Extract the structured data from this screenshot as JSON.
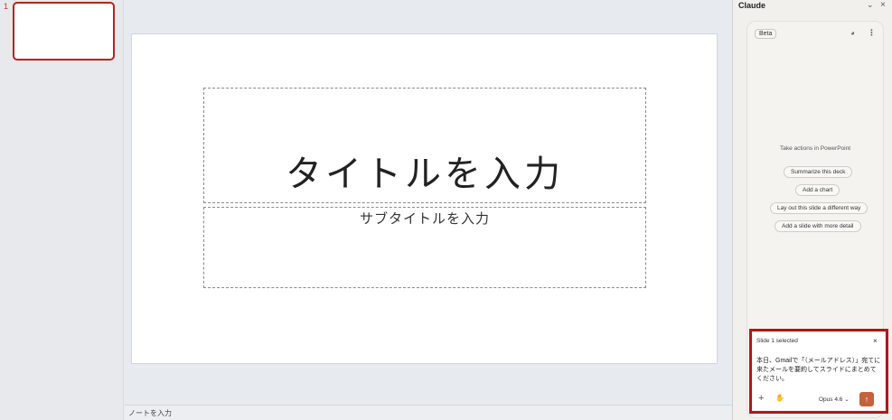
{
  "thumbnails": {
    "slide_number": "1"
  },
  "slide": {
    "title_placeholder": "タイトルを入力",
    "subtitle_placeholder": "サブタイトルを入力"
  },
  "notes": {
    "placeholder": "ノートを入力"
  },
  "claude_pane": {
    "title": "Claude",
    "badge": "Beta",
    "actions_heading": "Take actions in PowerPoint",
    "suggestions": [
      "Summarize this deck",
      "Add a chart",
      "Lay out this slide a different way",
      "Add a slide with more detail"
    ],
    "input": {
      "selection_label": "Slide 1 selected",
      "message": "本日、Gmailで「（メールアドレス）」宛てに来たメールを要約してスライドにまとめてください。",
      "model": "Opus 4.6"
    }
  },
  "colors": {
    "highlight": "#b01717",
    "send_button": "#c4623c",
    "thumb_border": "#b3261e"
  }
}
